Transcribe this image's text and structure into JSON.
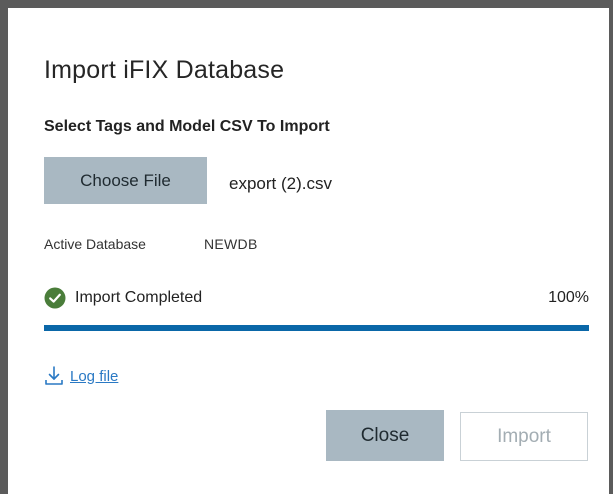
{
  "dialog": {
    "title": "Import iFIX Database",
    "subtitle": "Select Tags and Model CSV To Import"
  },
  "file": {
    "choose_label": "Choose File",
    "selected_name": "export (2).csv"
  },
  "database": {
    "label": "Active Database",
    "value": "NEWDB"
  },
  "status": {
    "icon": "check-circle-icon",
    "text": "Import Completed",
    "percent_label": "100%",
    "progress": 1.0,
    "success_color": "#4a7d3a",
    "progress_color": "#0a67a8"
  },
  "log": {
    "icon": "download-icon",
    "label": "Log file",
    "link_color": "#2a79c4"
  },
  "actions": {
    "close_label": "Close",
    "import_label": "Import"
  }
}
